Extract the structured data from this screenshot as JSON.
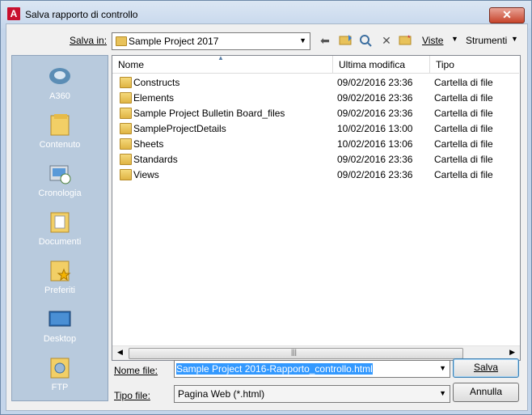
{
  "window": {
    "title": "Salva rapporto di controllo",
    "close": "✕",
    "app_icon": "A"
  },
  "toolbar": {
    "save_in_label": "Salva in:",
    "location": "Sample Project 2017",
    "views_label": "Viste",
    "tools_label": "Strumenti"
  },
  "places": [
    {
      "label": "A360",
      "icon": "a360-icon"
    },
    {
      "label": "Contenuto",
      "icon": "folder-icon"
    },
    {
      "label": "Cronologia",
      "icon": "history-icon"
    },
    {
      "label": "Documenti",
      "icon": "documents-icon"
    },
    {
      "label": "Preferiti",
      "icon": "favorites-icon"
    },
    {
      "label": "Desktop",
      "icon": "desktop-icon"
    },
    {
      "label": "FTP",
      "icon": "ftp-icon"
    }
  ],
  "columns": {
    "name": "Nome",
    "modified": "Ultima modifica",
    "type": "Tipo"
  },
  "files": [
    {
      "name": "Constructs",
      "modified": "09/02/2016 23:36",
      "type": "Cartella di file"
    },
    {
      "name": "Elements",
      "modified": "09/02/2016 23:36",
      "type": "Cartella di file"
    },
    {
      "name": "Sample Project Bulletin Board_files",
      "modified": "09/02/2016 23:36",
      "type": "Cartella di file"
    },
    {
      "name": "SampleProjectDetails",
      "modified": "10/02/2016 13:00",
      "type": "Cartella di file"
    },
    {
      "name": "Sheets",
      "modified": "10/02/2016 13:06",
      "type": "Cartella di file"
    },
    {
      "name": "Standards",
      "modified": "09/02/2016 23:36",
      "type": "Cartella di file"
    },
    {
      "name": "Views",
      "modified": "09/02/2016 23:36",
      "type": "Cartella di file"
    }
  ],
  "form": {
    "filename_label": "Nome file:",
    "filename_value": "Sample Project 2016-Rapporto_controllo.html",
    "filetype_label": "Tipo file:",
    "filetype_value": "Pagina Web (*.html)",
    "save_label": "Salva",
    "cancel_label": "Annulla"
  }
}
